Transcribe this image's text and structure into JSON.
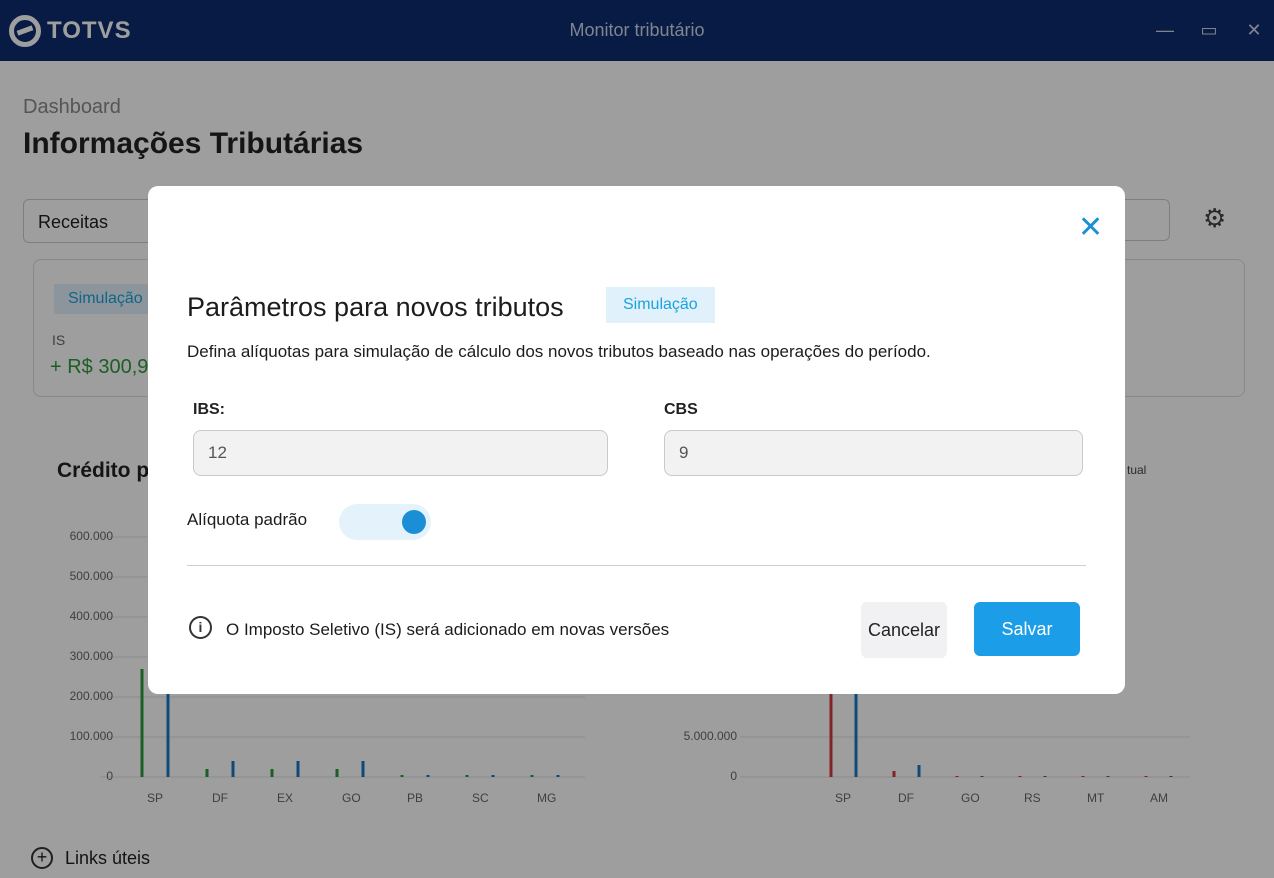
{
  "window": {
    "brand": "TOTVS",
    "title": "Monitor tributário",
    "min_glyph": "—",
    "max_glyph": "▭",
    "close_glyph": "✕"
  },
  "page": {
    "breadcrumb": "Dashboard",
    "title": "Informações Tributárias",
    "filter_tab": "Receitas",
    "card": {
      "badge": "Simulação",
      "label": "IS",
      "value": "+ R$ 300,9"
    },
    "left_chart_title": "Crédito p",
    "right_chart_legend": "tual",
    "links": "Links úteis"
  },
  "left_chart": {
    "y_ticks": [
      "600.000",
      "500.000",
      "400.000",
      "300.000",
      "200.000",
      "100.000",
      "0"
    ],
    "categories": [
      "SP",
      "DF",
      "EX",
      "GO",
      "PB",
      "SC",
      "MG"
    ],
    "series_colors": [
      "#2e9a3c",
      "#1677c7"
    ]
  },
  "right_chart": {
    "y_ticks": [
      "5.000.000",
      "0"
    ],
    "categories": [
      "SP",
      "DF",
      "GO",
      "RS",
      "MT",
      "AM"
    ],
    "series_colors": [
      "#d23b3b",
      "#1677c7"
    ]
  },
  "modal": {
    "close_glyph": "✕",
    "title": "Parâmetros para novos tributos",
    "badge": "Simulação",
    "description": "Defina alíquotas para simulação de cálculo dos novos tributos baseado nas operações do período.",
    "ibs_label": "IBS:",
    "ibs_value": "12",
    "cbs_label": "CBS",
    "cbs_value": "9",
    "toggle_label": "Alíquota padrão",
    "toggle_on": true,
    "info_glyph": "i",
    "info_text": "O Imposto Seletivo (IS) será adicionado em novas versões",
    "cancel_label": "Cancelar",
    "save_label": "Salvar"
  },
  "colors": {
    "titlebar": "#0c2c6e",
    "accent": "#1b9ee7",
    "badge_bg": "#e0f1fb",
    "positive": "#2e9a3c"
  }
}
